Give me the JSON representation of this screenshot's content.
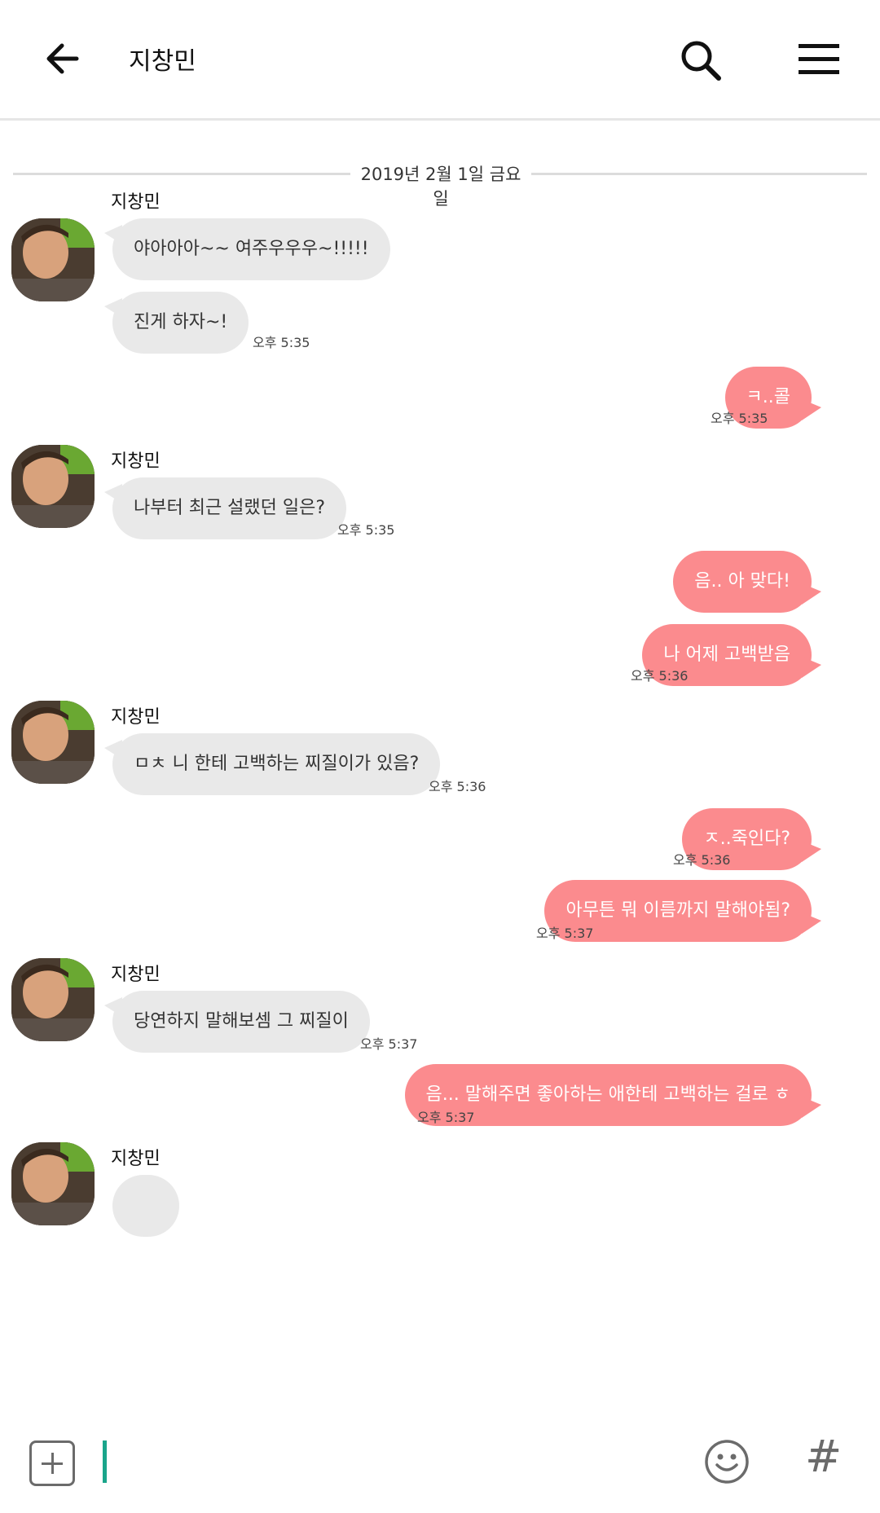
{
  "header": {
    "title": "지창민",
    "back_icon": "back-arrow-icon",
    "search_icon": "search-icon",
    "menu_icon": "hamburger-menu-icon"
  },
  "chat": {
    "date_divider": "2019년 2월 1일 금요일",
    "sender_name": "지창민",
    "messages": [
      {
        "from": "them",
        "text": "야아아아~~ 여주우우우~!!!!!"
      },
      {
        "from": "them",
        "text": "진게 하자~!",
        "time": "오후 5:35"
      },
      {
        "from": "me",
        "text": "ㅋ..콜",
        "time": "오후 5:35"
      },
      {
        "from": "them",
        "text": "나부터 최근 설랬던 일은?",
        "time": "오후 5:35"
      },
      {
        "from": "me",
        "text": "음.. 아 맞다!"
      },
      {
        "from": "me",
        "text": "나 어제 고백받음",
        "time": "오후 5:36"
      },
      {
        "from": "them",
        "text": "ㅁㅊ 니 한테 고백하는 찌질이가 있음?",
        "time": "오후 5:36"
      },
      {
        "from": "me",
        "text": "ㅈ..죽인다?",
        "time": "오후 5:36"
      },
      {
        "from": "me",
        "text": "아무튼 뭐 이름까지 말해야됨?",
        "time": "오후 5:37"
      },
      {
        "from": "them",
        "text": "당연하지 말해보셈 그 찌질이",
        "time": "오후 5:37"
      },
      {
        "from": "me",
        "text": "음... 말해주면 좋아하는 애한테 고백하는 걸로 ㅎ",
        "time": "오후 5:37"
      },
      {
        "from": "them",
        "text": ""
      }
    ]
  },
  "input_bar": {
    "plus_icon": "plus-box-icon",
    "placeholder": "",
    "emoji_icon": "smiley-icon",
    "hashtag_label": "#"
  },
  "colors": {
    "outgoing_bubble": "#fb8b8e",
    "incoming_bubble": "#e9e9e9",
    "caret": "#1aa58b"
  }
}
